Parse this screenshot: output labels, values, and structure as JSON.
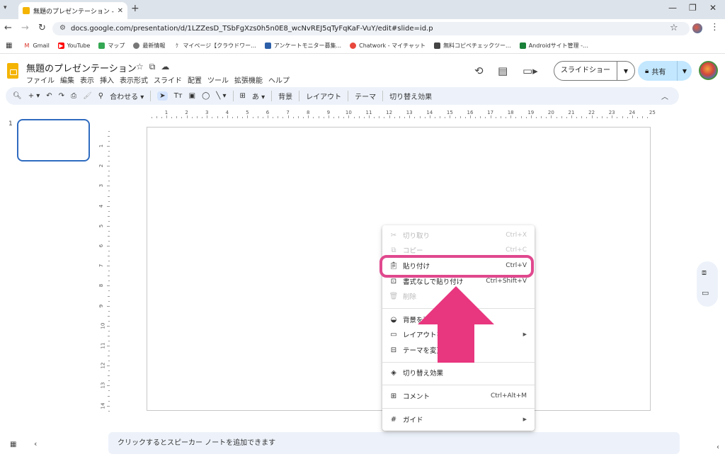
{
  "browser": {
    "tab_title": "無題のプレゼンテーション - Google",
    "url": "docs.google.com/presentation/d/1LZZesD_TSbFgXzs0h5n0E8_wcNvREJ5qTyFqKaF-VuY/edit#slide=id.p",
    "bookmarks": [
      "Gmail",
      "YouTube",
      "マップ",
      "最新情報",
      "マイページ【クラウドワー...",
      "アンケートモニター募集...",
      "Chatwork - マイチャット",
      "無料コピペチェックツー...",
      "Androidサイト管理 -..."
    ]
  },
  "doc": {
    "title": "無題のプレゼンテーション",
    "menu": [
      "ファイル",
      "編集",
      "表示",
      "挿入",
      "表示形式",
      "スライド",
      "配置",
      "ツール",
      "拡張機能",
      "ヘルプ"
    ],
    "slideshow_label": "スライドショー",
    "share_label": "共有"
  },
  "toolbar": {
    "fit_label": "合わせる",
    "background_label": "背景",
    "layout_label": "レイアウト",
    "theme_label": "テーマ",
    "transition_label": "切り替え効果"
  },
  "rulers": {
    "h_labels": [
      "1",
      "2",
      "3",
      "4",
      "5",
      "6",
      "7",
      "8",
      "9",
      "10",
      "11",
      "12",
      "13",
      "14",
      "15",
      "16",
      "17",
      "18",
      "19",
      "20",
      "21",
      "22",
      "23",
      "24",
      "25"
    ],
    "v_labels": [
      "1",
      "2",
      "3",
      "4",
      "5",
      "6",
      "7",
      "8",
      "9",
      "10",
      "11",
      "12",
      "13",
      "14"
    ]
  },
  "filmstrip": {
    "slide_number": "1"
  },
  "notes": {
    "placeholder": "クリックするとスピーカー ノートを追加できます"
  },
  "context_menu": {
    "items": [
      {
        "label": "切り取り",
        "shortcut": "Ctrl+X",
        "icon": "cut-icon",
        "disabled": true
      },
      {
        "label": "コピー",
        "shortcut": "Ctrl+C",
        "icon": "copy-icon",
        "disabled": true
      },
      {
        "label": "貼り付け",
        "shortcut": "Ctrl+V",
        "icon": "paste-icon",
        "disabled": false,
        "highlighted": true
      },
      {
        "label": "書式なしで貼り付け",
        "shortcut": "Ctrl+Shift+V",
        "icon": "paste-plain-icon",
        "disabled": false
      },
      {
        "label": "削除",
        "shortcut": "",
        "icon": "trash-icon",
        "disabled": true
      },
      {
        "label": "背景を変更",
        "shortcut": "",
        "icon": "fill-icon",
        "disabled": false
      },
      {
        "label": "レイアウトを適用",
        "shortcut": "",
        "icon": "layout-icon",
        "disabled": false,
        "submenu": true
      },
      {
        "label": "テーマを変更",
        "shortcut": "",
        "icon": "theme-icon",
        "disabled": false
      },
      {
        "label": "切り替え効果",
        "shortcut": "",
        "icon": "transition-icon",
        "disabled": false
      },
      {
        "label": "コメント",
        "shortcut": "Ctrl+Alt+M",
        "icon": "comment-add-icon",
        "disabled": false
      },
      {
        "label": "ガイド",
        "shortcut": "",
        "icon": "grid-icon",
        "disabled": false,
        "submenu": true
      }
    ]
  },
  "annotation": {
    "highlight_color": "#e0498e",
    "arrow_color": "#e8367f"
  }
}
